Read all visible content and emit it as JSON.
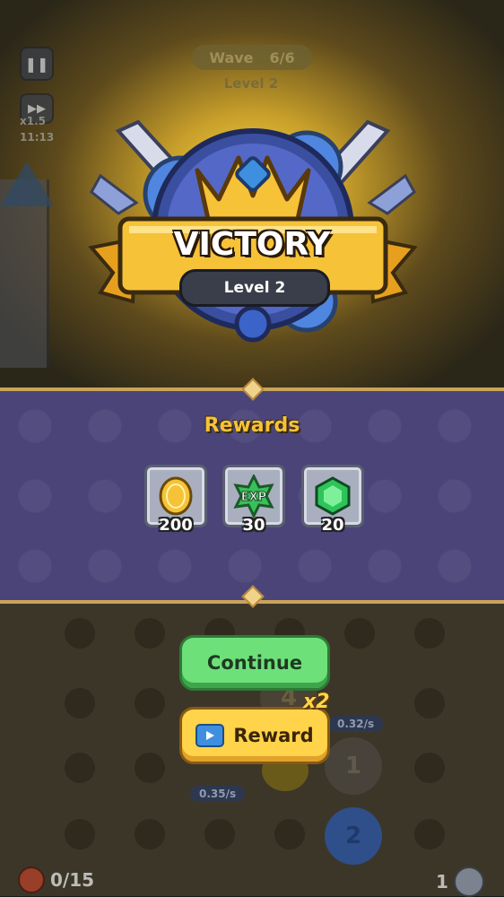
{
  "hud": {
    "pause_icon": "pause-icon",
    "speed_icon": "fast-forward-icon",
    "speed_label": "x1.5",
    "timer": "11:13",
    "wave_label": "Wave",
    "wave_value": "6/6",
    "level_label": "Level 2"
  },
  "banner": {
    "title": "VICTORY",
    "subtitle": "Level 2"
  },
  "rewards": {
    "title": "Rewards",
    "items": [
      {
        "icon": "gold-coin-icon",
        "amount": "200"
      },
      {
        "icon": "exp-icon",
        "icon_text": "EXP",
        "amount": "30"
      },
      {
        "icon": "green-gem-icon",
        "amount": "20"
      }
    ]
  },
  "buttons": {
    "continue": "Continue",
    "reward": "Reward",
    "reward_multiplier": "x2"
  },
  "board": {
    "rate_1": "0.32/s",
    "rate_2": "0.35/s",
    "slot_1": "1",
    "slot_2": "2",
    "slot_4": "4"
  },
  "footer": {
    "left_count": "0/15",
    "right_count": "1"
  },
  "colors": {
    "accent_gold": "#f6c238",
    "panel_purple": "#4a4478",
    "continue_green": "#6ee07a",
    "reward_yellow": "#ffd34a"
  }
}
